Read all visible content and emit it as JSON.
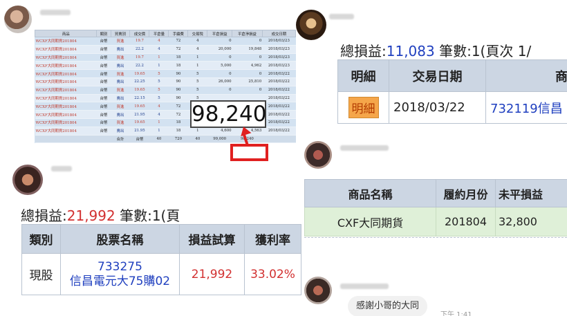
{
  "trade_table": {
    "headers": [
      "商品",
      "類別",
      "買賣別",
      "成交價",
      "平倉量",
      "手續費",
      "交易稅",
      "平倉損益",
      "平倉淨損益",
      "成交日期"
    ],
    "rows": [
      [
        "WCXF大同期貨201804",
        "台幣",
        "買進",
        "19.7",
        "4",
        "72",
        "4",
        "0",
        "0",
        "2018/03/23"
      ],
      [
        "WCXF大同期貨201804",
        "台幣",
        "賣出",
        "22.2",
        "4",
        "72",
        "4",
        "20,000",
        "19,848",
        "2018/03/23"
      ],
      [
        "WCXF大同期貨201804",
        "台幣",
        "買進",
        "19.7",
        "1",
        "18",
        "1",
        "0",
        "0",
        "2018/03/23"
      ],
      [
        "WCXF大同期貨201804",
        "台幣",
        "賣出",
        "22.2",
        "1",
        "18",
        "1",
        "5,000",
        "4,962",
        "2018/03/23"
      ],
      [
        "WCXF大同期貨201804",
        "台幣",
        "買進",
        "19.65",
        "5",
        "90",
        "5",
        "0",
        "0",
        "2018/03/22"
      ],
      [
        "WCXF大同期貨201804",
        "台幣",
        "賣出",
        "22.25",
        "5",
        "90",
        "5",
        "26,000",
        "25,810",
        "2018/03/22"
      ],
      [
        "WCXF大同期貨201804",
        "台幣",
        "買進",
        "19.65",
        "5",
        "90",
        "5",
        "0",
        "0",
        "2018/03/22"
      ],
      [
        "WCXF大同期貨201804",
        "台幣",
        "賣出",
        "22.15",
        "5",
        "90",
        "5",
        "",
        "",
        "2018/03/22"
      ],
      [
        "WCXF大同期貨201804",
        "台幣",
        "買進",
        "19.65",
        "4",
        "72",
        "4",
        "0",
        "0",
        "2018/03/22"
      ],
      [
        "WCXF大同期貨201804",
        "台幣",
        "賣出",
        "21.95",
        "4",
        "72",
        "4",
        "",
        "",
        "2018/03/22"
      ],
      [
        "WCXF大同期貨201804",
        "台幣",
        "買進",
        "19.65",
        "1",
        "18",
        "1",
        "0",
        "0",
        "2018/03/22"
      ],
      [
        "WCXF大同期貨201804",
        "台幣",
        "賣出",
        "21.95",
        "1",
        "18",
        "1",
        "4,600",
        "4,563",
        "2018/03/22"
      ]
    ],
    "total": [
      "",
      "合計",
      "台幣",
      "40",
      "720",
      "40",
      "99,000",
      "98,240",
      ""
    ],
    "zoom_value": "98,240"
  },
  "top_right": {
    "summary_prefix": "總損益:",
    "summary_value": "11,083",
    "summary_suffix": " 筆數:1(頁次 1/",
    "headers": [
      "明細",
      "交易日期",
      "商"
    ],
    "row": {
      "detail": "明細",
      "date": "2018/03/22",
      "product": "732119信昌"
    }
  },
  "futures": {
    "headers": [
      "商品名稱",
      "履約月份",
      "未平損益"
    ],
    "row": [
      "CXF大同期貨",
      "201804",
      "32,800"
    ]
  },
  "bottom_left": {
    "summary_prefix": "總損益:",
    "summary_value": "21,992",
    "summary_suffix": " 筆數:1(頁",
    "headers": [
      "類別",
      "股票名稱",
      "損益試算",
      "獲利率"
    ],
    "row": {
      "category": "現股",
      "stock_code": "733275",
      "stock_name": "信昌電元大75購02",
      "pnl": "21,992",
      "rate": "33.02%"
    }
  },
  "chat": {
    "message": "感謝小哥的大同",
    "time": "下午 1:41"
  },
  "colors": {
    "red": "#d23030",
    "blue": "#1f3fbf",
    "header_bg": "#ccd6e3",
    "highlight": "#e02020"
  }
}
